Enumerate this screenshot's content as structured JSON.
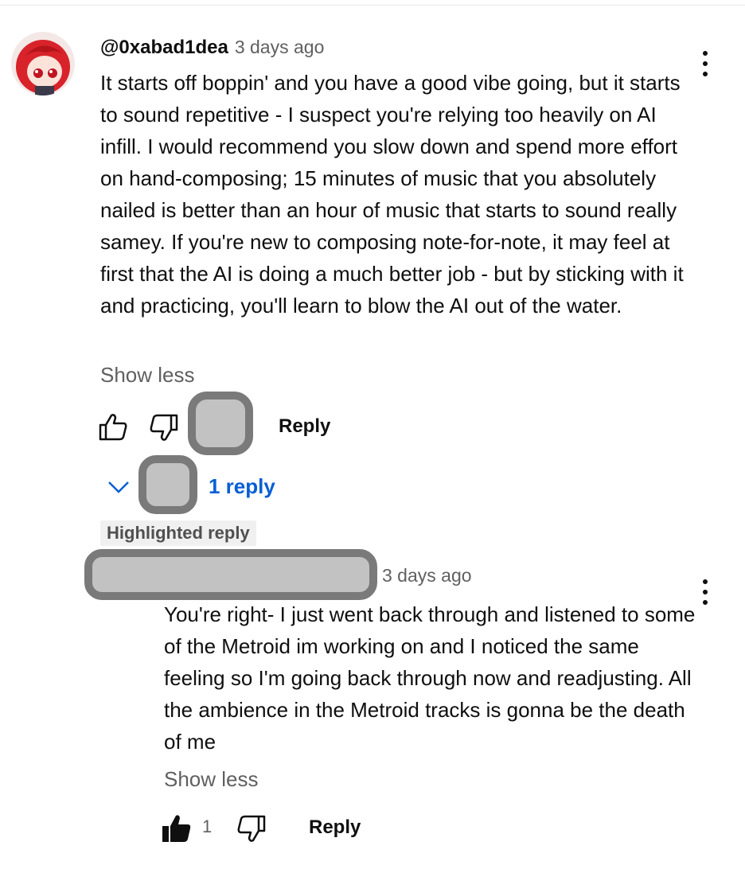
{
  "comment": {
    "author": "@0xabad1dea",
    "time": "3 days ago",
    "text": "It starts off boppin' and you have a good vibe going, but it starts to sound repetitive - I suspect you're relying too heavily on AI infill. I would recommend you slow down and spend more effort on hand-composing; 15 minutes of music that you absolutely nailed is better than an hour of music that starts to sound really samey. If you're new to composing note-for-note, it may feel at first that the AI is doing a much better job - but by sticking with it and practicing, you'll learn to blow the AI out of the water.",
    "show_less": "Show less",
    "reply_label": "Reply",
    "replies_label": "1 reply",
    "icons": [
      "avatar",
      "more-vert-icon",
      "thumbs-up-icon",
      "thumbs-down-icon",
      "chevron-down-icon"
    ]
  },
  "reply": {
    "badge": "Highlighted reply",
    "time": "3 days ago",
    "text": "You're right- I just went back through and listened to some of the Metroid im working on and I noticed the same feeling so I'm going back through now and readjusting. All the ambience in the Metroid tracks is gonna be the death of me",
    "show_less": "Show less",
    "like_count": "1",
    "reply_label": "Reply",
    "icons": [
      "more-vert-icon",
      "thumbs-up-filled-icon",
      "thumbs-down-icon"
    ]
  },
  "colors": {
    "link_blue": "#065fd4",
    "secondary_text": "#606060",
    "redaction_fill": "#c2c2c2",
    "redaction_border": "#7a7a7a"
  }
}
